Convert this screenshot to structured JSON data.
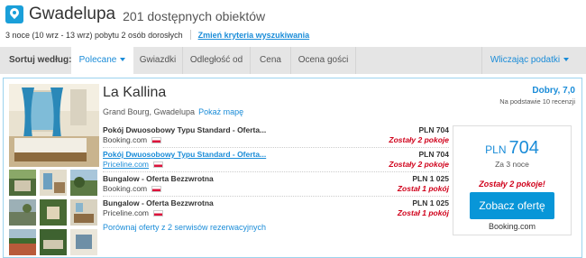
{
  "header": {
    "title": "Gwadelupa",
    "count": "201 dostępnych obiektów"
  },
  "subline": {
    "trip": "3 noce (10 wrz - 13 wrz) pobytu 2 osób dorosłych",
    "change_link": "Zmień kryteria wyszukiwania"
  },
  "sortbar": {
    "label": "Sortuj według:",
    "options": [
      "Polecane",
      "Gwiazdki",
      "Odległość od",
      "Cena",
      "Ocena gości"
    ],
    "active": "Polecane",
    "tax_toggle": "Wliczając podatki"
  },
  "hotel": {
    "name": "La Kallina",
    "address": "Grand Bourg, Gwadelupa",
    "map_link": "Pokaż mapę",
    "rating_label": "Dobry, 7,0",
    "rating_sub": "Na podstawie 10 recenzji",
    "deals": [
      {
        "name": "Pokój Dwuosobowy Typu Standard - Oferta...",
        "provider": "Booking.com",
        "price": "PLN 704",
        "left": "Zostały 2 pokoje"
      },
      {
        "name": "Pokój Dwuosobowy Typu Standard - Oferta...",
        "provider": "Priceline.com",
        "price": "PLN 704",
        "left": "Zostały 2 pokoje"
      },
      {
        "name": "Bungalow - Oferta Bezzwrotna",
        "provider": "Booking.com",
        "price": "PLN 1 025",
        "left": "Został 1 pokój"
      },
      {
        "name": "Bungalow - Oferta Bezzwrotna",
        "provider": "Priceline.com",
        "price": "PLN 1 025",
        "left": "Został 1 pokój"
      }
    ],
    "compare_link": "Porównaj oferty z 2 serwisów rezerwacyjnych",
    "best": {
      "currency": "PLN",
      "amount": "704",
      "nights": "Za 3 noce",
      "left": "Zostały 2 pokoje!",
      "cta": "Zobacz ofertę",
      "provider": "Booking.com"
    }
  },
  "colors": {
    "accent": "#1a8cd8",
    "cta": "#0896d8",
    "alert": "#d0021b",
    "sortbar": "#e5e5e5",
    "card_border": "#9cd3ee"
  },
  "icons": {
    "location": "map-pin-icon",
    "dropdown": "caret-down-icon",
    "flag": "poland-flag-icon"
  }
}
